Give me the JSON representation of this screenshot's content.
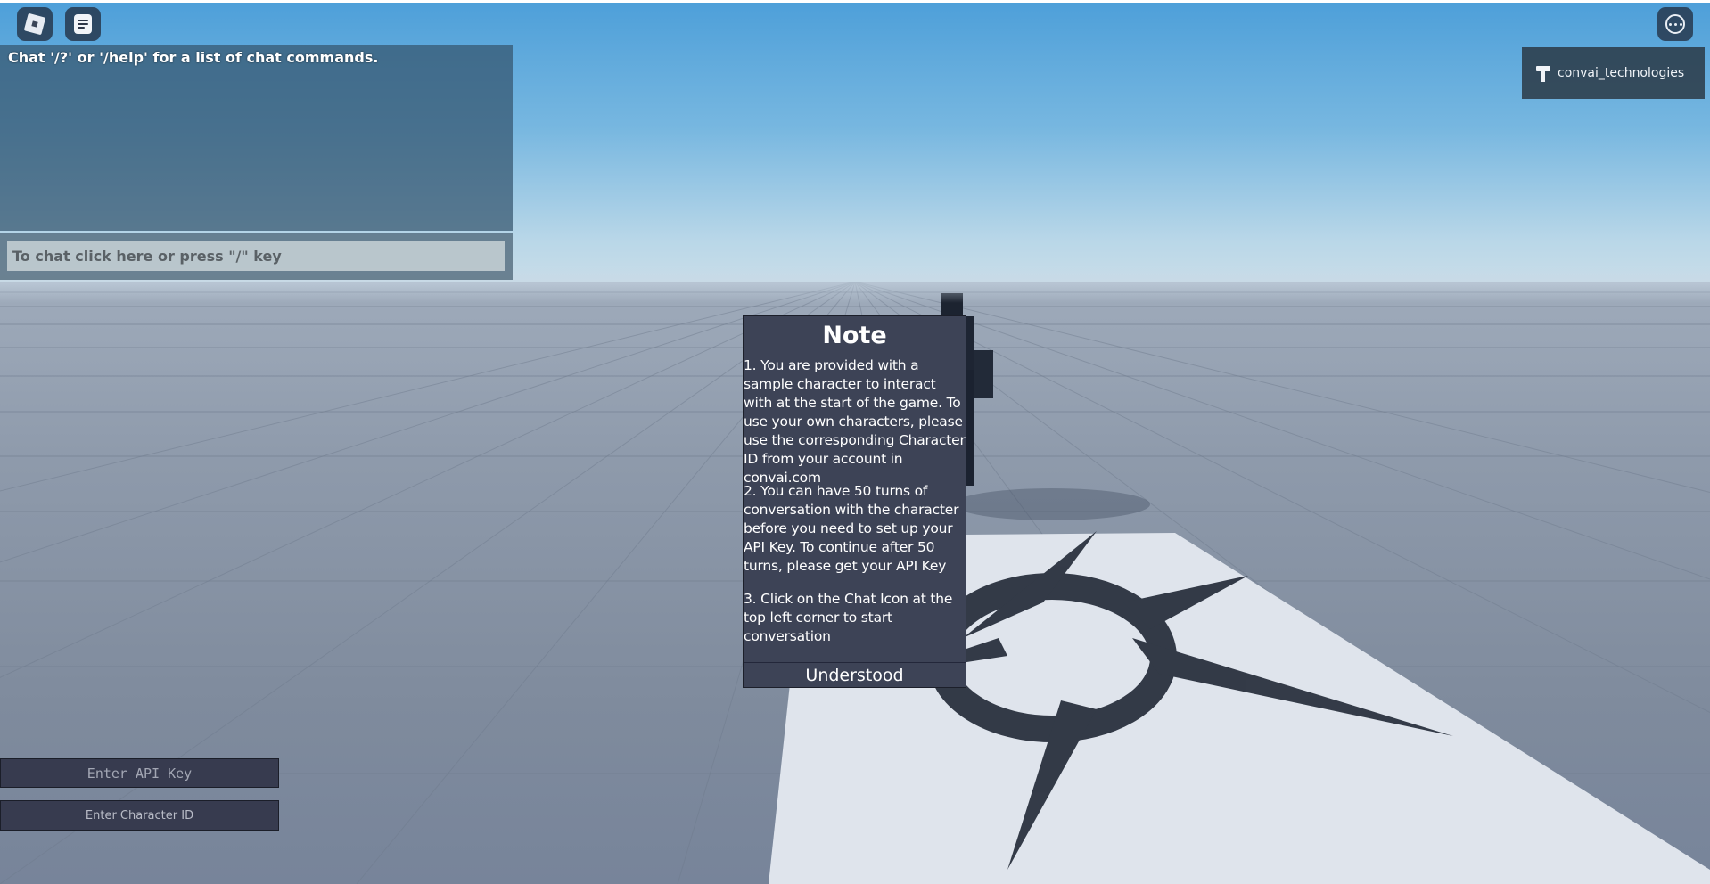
{
  "hud": {
    "roblox_menu_icon": "roblox-logo-icon",
    "chat_toggle_icon": "chat-icon",
    "more_menu_icon": "more-options-icon"
  },
  "chat": {
    "system_message": "Chat '/?' or '/help' for a list of chat commands.",
    "input_placeholder": "To chat click here or press \"/\" key"
  },
  "player_card": {
    "icon": "hammer-icon",
    "username": "convai_technologies"
  },
  "note": {
    "title": "Note",
    "paragraphs": [
      "1. You are provided with a sample character to interact with at the start of the game. To use your own characters, please use the corresponding Character ID from your account in convai.com",
      "2. You can have 50 turns of conversation with the character before you need to set up your API Key. To continue after 50 turns, please get your API Key",
      "3. Click on the Chat Icon at the top left corner to start conversation"
    ],
    "button_label": "Understood"
  },
  "inputs": {
    "api_key_placeholder": "Enter API Key",
    "character_id_placeholder": "Enter Character ID"
  },
  "colors": {
    "sky_top": "#4d9fd9",
    "ground": "#8e9aab",
    "dialog_bg": "#3d4356",
    "input_bg": "#373b4f"
  }
}
